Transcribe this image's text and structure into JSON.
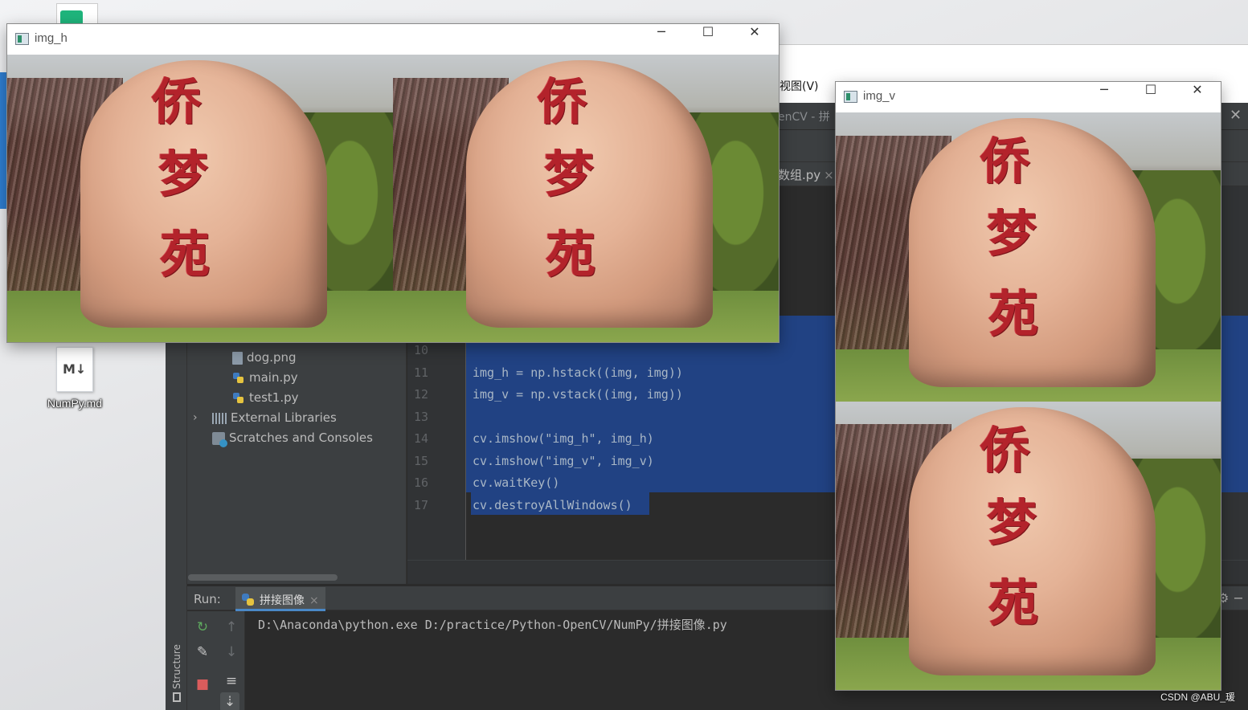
{
  "desktop": {
    "file_name": "NumPy.md",
    "file_icon_text": "M↓"
  },
  "background_app": {
    "menu_fragment": "视图(V)"
  },
  "ide": {
    "title_fragment": "enCV - 拼",
    "editor_tab": "数组.py",
    "project_tree": [
      {
        "name": "dog.png",
        "type": "png"
      },
      {
        "name": "main.py",
        "type": "py"
      },
      {
        "name": "test1.py",
        "type": "py"
      },
      {
        "name": "External Libraries",
        "type": "lib"
      },
      {
        "name": "Scratches and Consoles",
        "type": "scratch"
      }
    ],
    "line_numbers": [
      "10",
      "11",
      "12",
      "13",
      "14",
      "15",
      "16",
      "17"
    ],
    "code": {
      "l11": "img_h = np.hstack((img, img))",
      "l12": "img_v = np.vstack((img, img))",
      "l14": "cv.imshow(\"img_h\", img_h)",
      "l15": "cv.imshow(\"img_v\", img_v)",
      "l16": "cv.waitKey()",
      "l17": "cv.destroyAllWindows()"
    },
    "structure_label": "Structure",
    "run": {
      "label": "Run:",
      "tab": "拼接图像",
      "console": "D:\\Anaconda\\python.exe D:/practice/Python-OpenCV/NumPy/拼接图像.py"
    }
  },
  "windows": {
    "img_h": {
      "title": "img_h"
    },
    "img_v": {
      "title": "img_v"
    }
  },
  "photo_text": {
    "chars": [
      "侨",
      "梦",
      "苑"
    ]
  },
  "watermark": "CSDN @ABU_瑗",
  "colors": {
    "ide_bg": "#2b2b2b",
    "selection": "#214283",
    "string": "#6a8759",
    "keyword": "#cc7832"
  }
}
